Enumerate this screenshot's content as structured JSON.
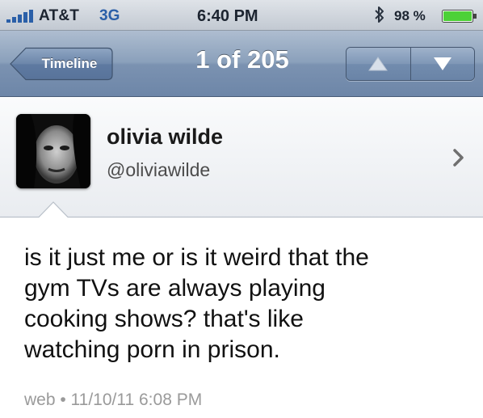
{
  "status_bar": {
    "carrier": "AT&T",
    "network": "3G",
    "time": "6:40 PM",
    "battery_percent": "98 %",
    "icons": [
      "signal-bars-icon",
      "bluetooth-icon",
      "battery-icon"
    ]
  },
  "nav": {
    "back_label": "Timeline",
    "title": "1 of 205",
    "controls": [
      "arrow-up-icon",
      "arrow-down-icon"
    ]
  },
  "profile": {
    "display_name": "olivia wilde",
    "username": "@oliviawilde"
  },
  "tweet": {
    "lines": [
      "is it just me or is it weird that the",
      "gym TVs are always playing",
      "cooking shows? that's like",
      "watching porn in prison."
    ],
    "meta": "web • 11/10/11 6:08 PM"
  },
  "colors": {
    "nav_bar": "#7b92b1",
    "network_text": "#2a5fa8",
    "battery_fill": "#4cd137"
  }
}
